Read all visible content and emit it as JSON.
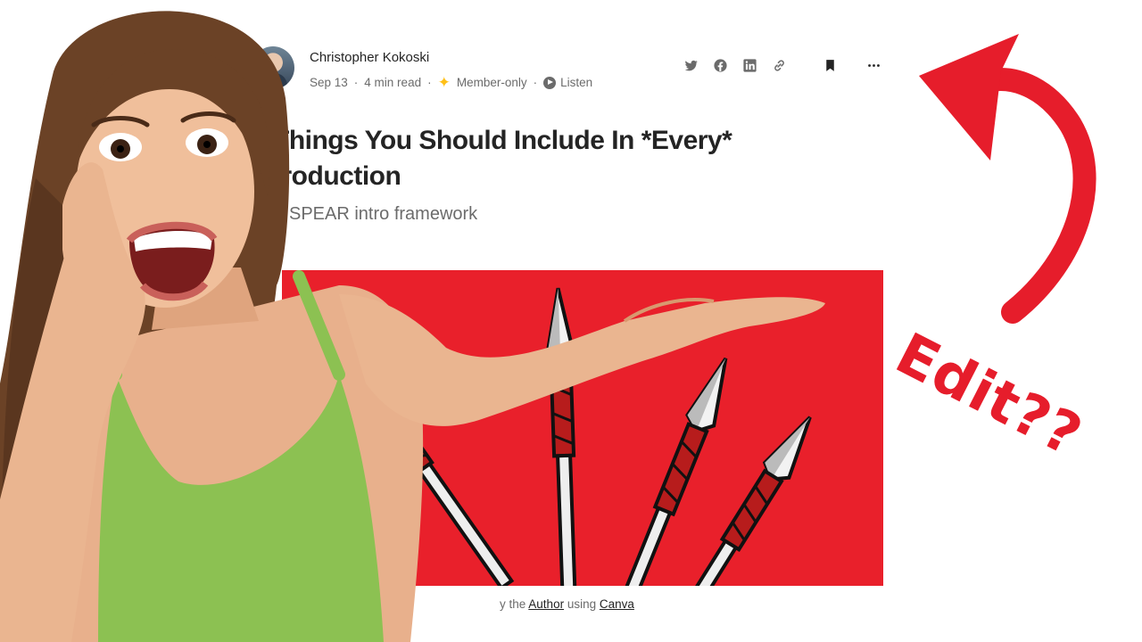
{
  "author": {
    "name": "Christopher Kokoski",
    "avatar_icon": "author-avatar"
  },
  "meta": {
    "date": "Sep 13",
    "read_time": "4 min read",
    "member_icon": "sparkle-icon",
    "member_label": "Member-only",
    "listen_icon": "play-circle-icon",
    "listen_label": "Listen",
    "separator": "·"
  },
  "actions": {
    "icons": [
      "twitter-icon",
      "facebook-icon",
      "linkedin-icon",
      "link-icon",
      "bookmark-icon",
      "more-icon"
    ]
  },
  "article": {
    "title_line1": "Things You Should Include In *Every*",
    "title_line2": "troduction",
    "subtitle": "SPEAR intro framework"
  },
  "caption": {
    "prefix": "y the",
    "author_link": "Author",
    "middle": "using",
    "canva_link": "Canva"
  },
  "annotation": {
    "text": "Edit??",
    "color": "#e61d2b",
    "arrow": "curved-arrow-icon"
  },
  "colors": {
    "hero_background": "#e9202b",
    "shirt": "#8cc152",
    "text_primary": "#242424",
    "text_secondary": "#6b6b6b",
    "member_star": "#ffc017"
  }
}
